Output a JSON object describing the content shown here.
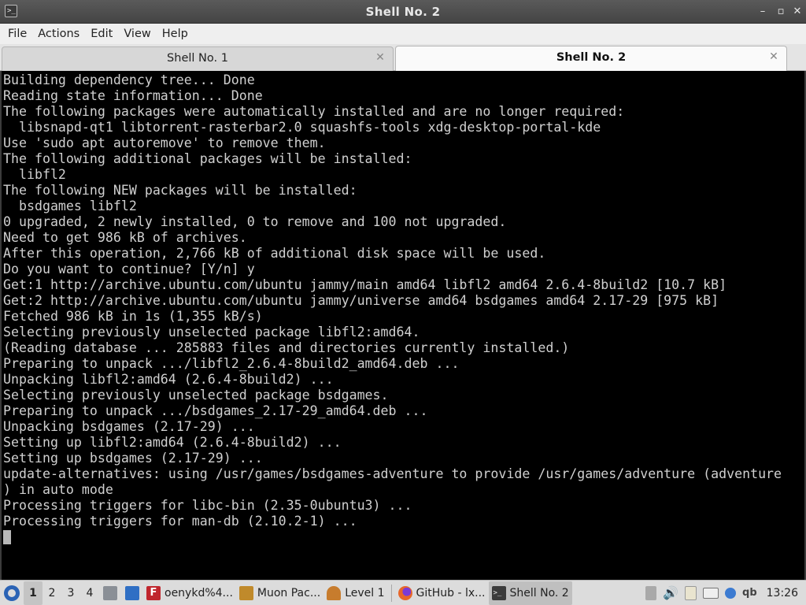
{
  "window": {
    "title": "Shell No. 2",
    "icon": "terminal-icon",
    "buttons": {
      "minimize": "–",
      "maximize": "▫",
      "close": "✕"
    }
  },
  "menu": [
    "File",
    "Actions",
    "Edit",
    "View",
    "Help"
  ],
  "tabs": [
    {
      "label": "Shell No. 1",
      "active": false
    },
    {
      "label": "Shell No. 2",
      "active": true
    }
  ],
  "terminal": {
    "lines": [
      "Building dependency tree... Done",
      "Reading state information... Done",
      "The following packages were automatically installed and are no longer required:",
      "  libsnapd-qt1 libtorrent-rasterbar2.0 squashfs-tools xdg-desktop-portal-kde",
      "Use 'sudo apt autoremove' to remove them.",
      "The following additional packages will be installed:",
      "  libfl2",
      "The following NEW packages will be installed:",
      "  bsdgames libfl2",
      "0 upgraded, 2 newly installed, 0 to remove and 100 not upgraded.",
      "Need to get 986 kB of archives.",
      "After this operation, 2,766 kB of additional disk space will be used.",
      "Do you want to continue? [Y/n] y",
      "Get:1 http://archive.ubuntu.com/ubuntu jammy/main amd64 libfl2 amd64 2.6.4-8build2 [10.7 kB]",
      "Get:2 http://archive.ubuntu.com/ubuntu jammy/universe amd64 bsdgames amd64 2.17-29 [975 kB]",
      "Fetched 986 kB in 1s (1,355 kB/s)",
      "Selecting previously unselected package libfl2:amd64.",
      "(Reading database ... 285883 files and directories currently installed.)",
      "Preparing to unpack .../libfl2_2.6.4-8build2_amd64.deb ...",
      "Unpacking libfl2:amd64 (2.6.4-8build2) ...",
      "Selecting previously unselected package bsdgames.",
      "Preparing to unpack .../bsdgames_2.17-29_amd64.deb ...",
      "Unpacking bsdgames (2.17-29) ...",
      "Setting up libfl2:amd64 (2.6.4-8build2) ...",
      "Setting up bsdgames (2.17-29) ...",
      "update-alternatives: using /usr/games/bsdgames-adventure to provide /usr/games/adventure (adventure",
      ") in auto mode",
      "Processing triggers for libc-bin (2.35-0ubuntu3) ...",
      "Processing triggers for man-db (2.10.2-1) ..."
    ]
  },
  "taskbar": {
    "workspaces": [
      "1",
      "2",
      "3",
      "4"
    ],
    "active_workspace": "1",
    "tasks": [
      {
        "label": "oenykd%4...",
        "icon": "filezilla-icon",
        "color": "#c0262d"
      },
      {
        "label": "Muon Pac...",
        "icon": "package-manager-icon",
        "color": "#c08a2b"
      },
      {
        "label": "Level 1",
        "icon": "game-icon",
        "color": "#c77c2d"
      },
      {
        "label": "GitHub - lx...",
        "icon": "firefox-icon",
        "color": "#e8672a"
      },
      {
        "label": "Shell No. 2",
        "icon": "terminal-icon",
        "color": "#3b3b3b",
        "active": true
      }
    ],
    "tray_text": "qb",
    "clock": "13:26"
  }
}
